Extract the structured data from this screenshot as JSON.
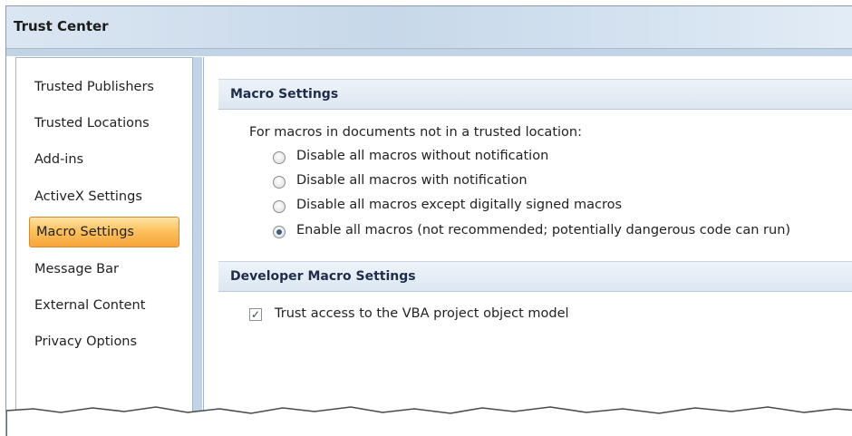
{
  "window": {
    "title": "Trust Center"
  },
  "sidebar": {
    "items": [
      {
        "label": "Trusted Publishers",
        "selected": false
      },
      {
        "label": "Trusted Locations",
        "selected": false
      },
      {
        "label": "Add-ins",
        "selected": false
      },
      {
        "label": "ActiveX Settings",
        "selected": false
      },
      {
        "label": "Macro Settings",
        "selected": true
      },
      {
        "label": "Message Bar",
        "selected": false
      },
      {
        "label": "External Content",
        "selected": false
      },
      {
        "label": "Privacy Options",
        "selected": false
      }
    ]
  },
  "macro_settings": {
    "header": "Macro Settings",
    "intro": "For macros in documents not in a trusted location:",
    "options": [
      {
        "label": "Disable all macros without notification",
        "checked": false
      },
      {
        "label": "Disable all macros with notification",
        "checked": false
      },
      {
        "label": "Disable all macros except digitally signed macros",
        "checked": false
      },
      {
        "label": "Enable all macros (not recommended; potentially dangerous code can run)",
        "checked": true
      }
    ]
  },
  "developer_settings": {
    "header": "Developer Macro Settings",
    "trust_vba": {
      "label": "Trust access to the VBA project object model",
      "checked": true
    }
  },
  "colors": {
    "selected_item": "#fbc25e",
    "frame": "#c3d3e6",
    "section_header": "#dde7f1"
  }
}
